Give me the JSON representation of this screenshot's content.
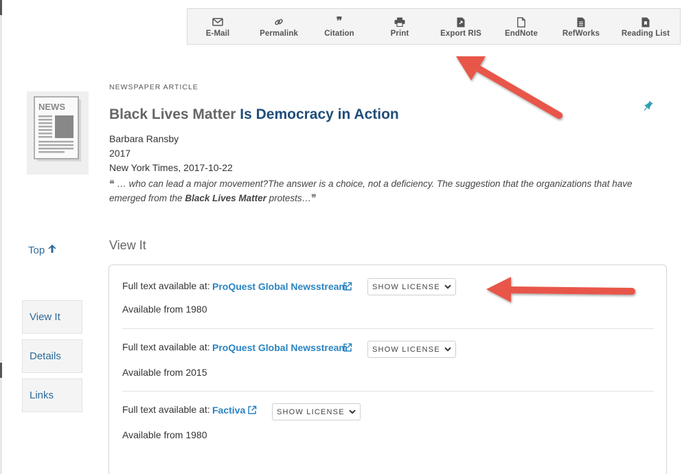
{
  "toolbar": {
    "items": [
      {
        "label": "E-Mail",
        "icon": "email-icon"
      },
      {
        "label": "Permalink",
        "icon": "link-icon"
      },
      {
        "label": "Citation",
        "icon": "quote-icon"
      },
      {
        "label": "Print",
        "icon": "printer-icon"
      },
      {
        "label": "Export RIS",
        "icon": "file-export-icon"
      },
      {
        "label": "EndNote",
        "icon": "file-icon"
      },
      {
        "label": "RefWorks",
        "icon": "file-text-icon"
      },
      {
        "label": "Reading List",
        "icon": "file-bookmark-icon"
      }
    ]
  },
  "record": {
    "type": "NEWSPAPER ARTICLE",
    "title_plain": "Black Lives Matter",
    "title_highlight": "Is Democracy in Action",
    "author": "Barbara Ransby",
    "year": "2017",
    "source": "New York Times, 2017-10-22",
    "snippet_prefix": "… who can lead a major movement?The answer is a choice, not a deficiency. The suggestion that the organizations that have emerged from the",
    "snippet_bold": "Black Lives Matter",
    "snippet_suffix": "protests…",
    "thumbnail_word": "NEWS"
  },
  "sidenav": {
    "top_label": "Top",
    "items": [
      "View It",
      "Details",
      "Links"
    ]
  },
  "viewit": {
    "heading": "View It",
    "services": [
      {
        "label": "Full text available at:",
        "provider": "ProQuest Global Newsstream",
        "license": "SHOW LICENSE",
        "availability": "Available from 1980"
      },
      {
        "label": "Full text available at:",
        "provider": "ProQuest Global Newsstream",
        "license": "SHOW LICENSE",
        "availability": "Available from 2015"
      },
      {
        "label": "Full text available at:",
        "provider": "Factiva",
        "license": "SHOW LICENSE",
        "availability": "Available from 1980"
      }
    ]
  },
  "colors": {
    "link": "#2a84c2",
    "title_highlight": "#1f4e79",
    "arrow": "#e8574a",
    "pin": "#2a9fb0"
  }
}
